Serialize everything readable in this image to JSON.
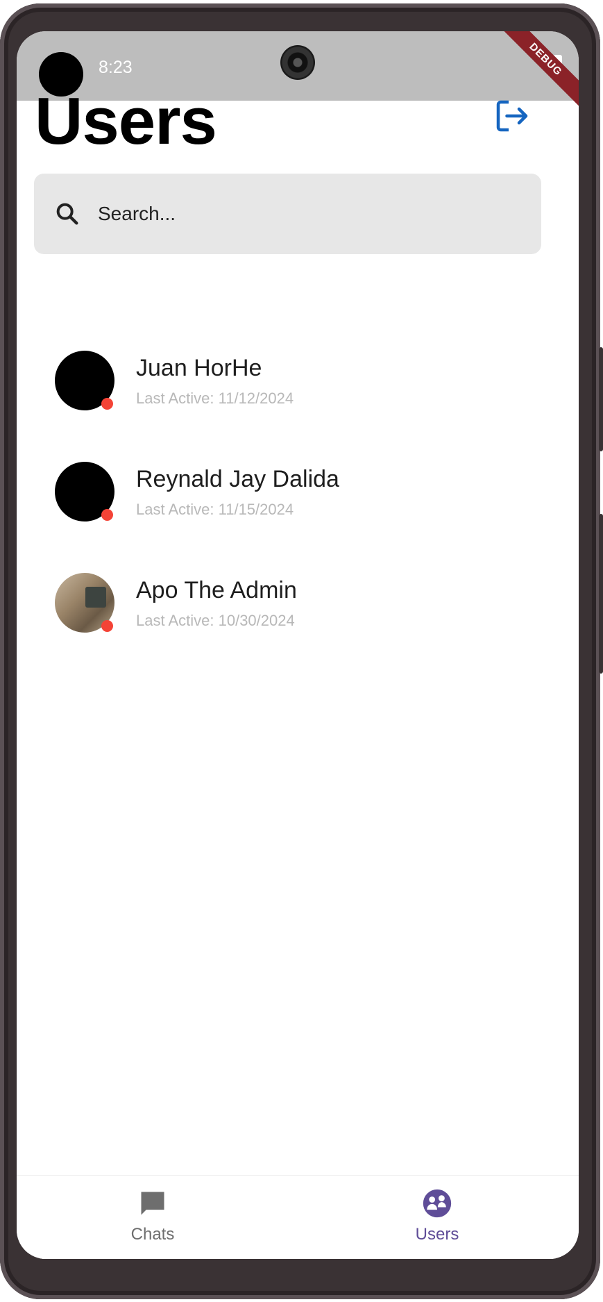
{
  "status_bar": {
    "time": "8:23",
    "debug_label": "DEBUG"
  },
  "header": {
    "title": "Users",
    "logout_icon": "logout-icon",
    "accent": "#1565c0"
  },
  "search": {
    "placeholder": "Search..."
  },
  "users": [
    {
      "name": "Juan HorHe",
      "last_active": "Last Active: 11/12/2024",
      "avatar": "black"
    },
    {
      "name": "Reynald Jay Dalida",
      "last_active": "Last Active: 11/15/2024",
      "avatar": "black"
    },
    {
      "name": "Apo The Admin",
      "last_active": "Last Active: 10/30/2024",
      "avatar": "photo"
    }
  ],
  "nav": {
    "chats_label": "Chats",
    "users_label": "Users",
    "active": "users",
    "active_color": "#5f4d98",
    "inactive_color": "#6e6e6e"
  },
  "colors": {
    "status_offline": "#f44336",
    "search_bg": "#e7e7e7"
  }
}
